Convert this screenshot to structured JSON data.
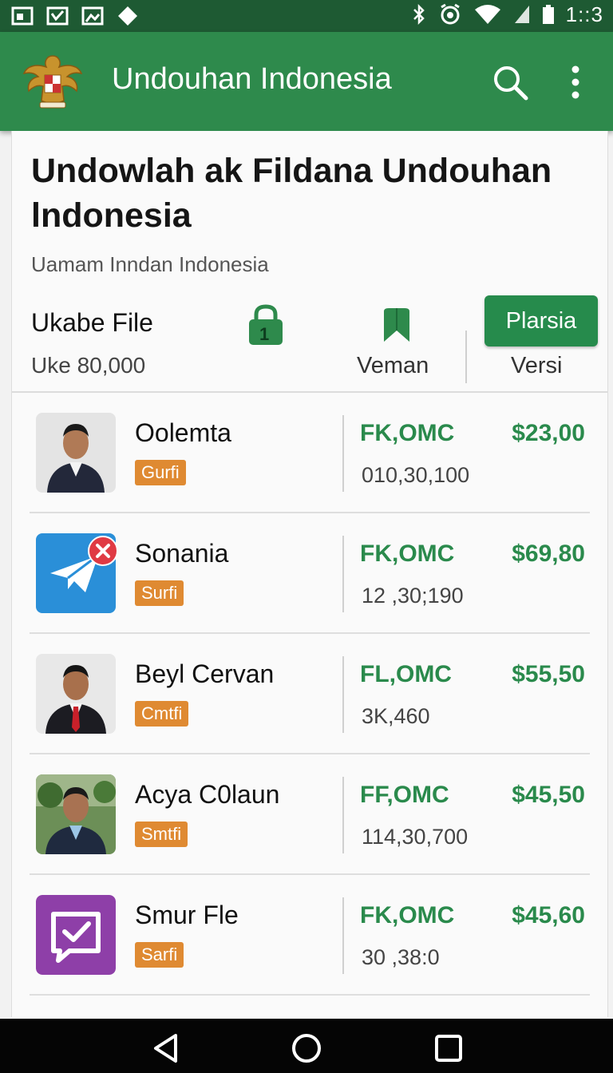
{
  "status_bar": {
    "time": "1::3"
  },
  "app_bar": {
    "title": "Undouhan Indonesia",
    "emblem": "garuda-emblem-icon",
    "search_icon": "search-icon",
    "menu_icon": "more-vert-icon"
  },
  "page": {
    "heading": "Undowlah ak Fildana Undouhan lndonesia",
    "subtitle": "Uamam Inndan Indonesia"
  },
  "summary": {
    "label": "Ukabe File",
    "value": "Uke 80,000",
    "lock_badge": "1",
    "col1_label": "Veman",
    "button_label": "Plarsia",
    "col2_label": "Versi"
  },
  "colors": {
    "primary": "#2e8a4c",
    "status_bar": "#1e5a33",
    "badge": "#df8a32",
    "accent_text": "#2a8a4c"
  },
  "items": [
    {
      "name": "Oolemta",
      "badge": "Gurfi",
      "code": "FK,OMC",
      "price": "$23,00",
      "count": "010,30,100",
      "thumb": "person-avatar-1"
    },
    {
      "name": "Sonania",
      "badge": "Surfi",
      "code": "FK,OMC",
      "price": "$69,80",
      "count": "12 ,30;190",
      "thumb": "telegram-app-icon"
    },
    {
      "name": "Beyl Cervan",
      "badge": "Cmtfi",
      "code": "FL,OMC",
      "price": "$55,50",
      "count": "3K,460",
      "thumb": "person-avatar-2"
    },
    {
      "name": "Acya C0laun",
      "badge": "Smtfi",
      "code": "FF,OMC",
      "price": "$45,50",
      "count": "114,30,700",
      "thumb": "person-avatar-3"
    },
    {
      "name": "Smur Fle",
      "badge": "Sarfi",
      "code": "FK,OMC",
      "price": "$45,60",
      "count": "30 ,38:0",
      "thumb": "chat-check-app-icon"
    }
  ]
}
